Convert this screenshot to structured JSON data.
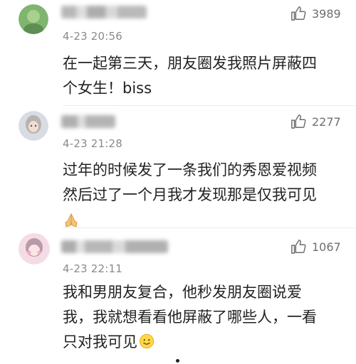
{
  "comments": [
    {
      "time": "4-23 20:56",
      "likes": "3989",
      "lines": [
        "在一起第三天，朋友圈发我照片屏蔽四",
        "个女生！biss"
      ],
      "avatar_icon": "avatar-green-blurred",
      "username_blurred": true
    },
    {
      "time": "4-23 21:28",
      "likes": "2277",
      "lines": [
        "过年的时候发了一条我们的秀恩爱视频",
        "然后过了一个月我才发现那是仅我可见"
      ],
      "emoji_icon": "praying-hands-icon",
      "avatar_icon": "avatar-girl-blurred",
      "username_blurred": true
    },
    {
      "time": "4-23 22:11",
      "likes": "1067",
      "lines": [
        "我和男朋友复合，他秒发朋友圈说爱",
        "我，我就想看看他屏蔽了哪些人，一看",
        "只对我可见"
      ],
      "emoji_icon": "smiling-face-icon",
      "avatar_icon": "avatar-pink-blurred",
      "username_blurred": true
    }
  ],
  "colors": {
    "timestamp": "#8a8a8a",
    "like_icon": "#6e6e6e",
    "text": "#222222"
  }
}
